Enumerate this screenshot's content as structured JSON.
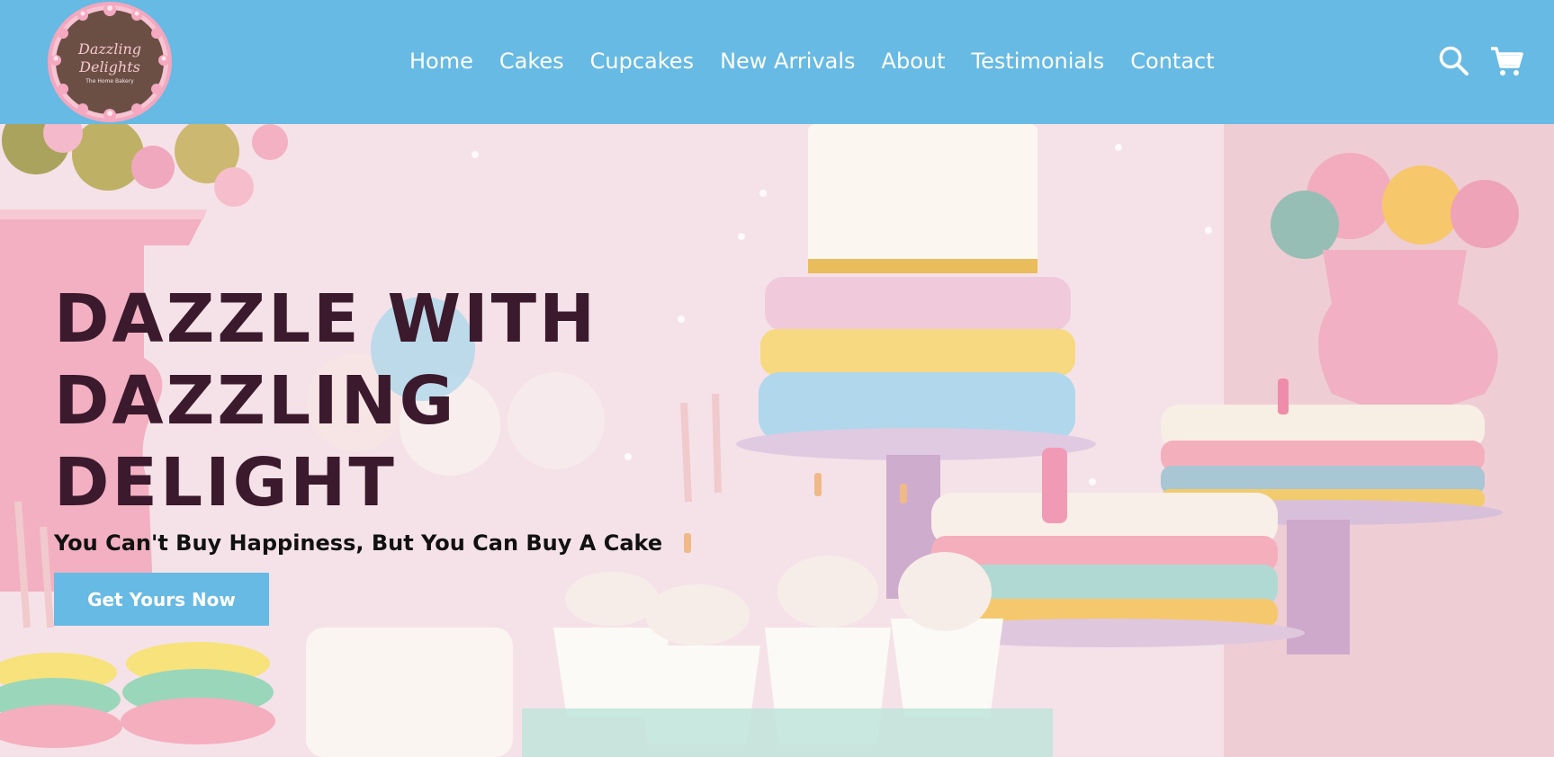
{
  "brand": {
    "logo_name": "Dazzling Delights",
    "logo_line1": "Dazzling",
    "logo_line2": "Delights",
    "logo_tagline": "The Home Bakery"
  },
  "nav": {
    "items": [
      {
        "label": "Home"
      },
      {
        "label": "Cakes"
      },
      {
        "label": "Cupcakes"
      },
      {
        "label": "New Arrivals"
      },
      {
        "label": "About"
      },
      {
        "label": "Testimonials"
      },
      {
        "label": "Contact"
      }
    ],
    "icons": [
      "search-icon",
      "cart-icon"
    ]
  },
  "hero": {
    "title_line1": "DAZZLE WITH",
    "title_line2": "DAZZLING",
    "title_line3": "DELIGHT",
    "tagline": "You Can't Buy Happiness, But You Can Buy A Cake",
    "cta_label": "Get Yours Now"
  },
  "colors": {
    "navbar": "#67bae3",
    "button": "#67bae3",
    "title_text": "#3a1a2c"
  }
}
